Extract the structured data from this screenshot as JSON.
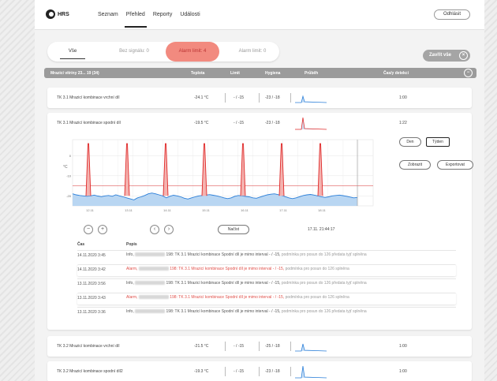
{
  "app": {
    "logo_text": "HRS"
  },
  "nav": [
    "Seznam",
    "Přehled",
    "Reporty",
    "Události"
  ],
  "logout_label": "Odhlásit",
  "filters": {
    "all": "Vše",
    "no_signal": "Bez signálu: 0",
    "alarm": "Alarm limit: 4",
    "alarm2": "Alarm limit: 0"
  },
  "close_all": "Zavřít vše",
  "table_header": {
    "device": "Mrazicí vitríny 23... 19 (34)",
    "temp": "Teplota",
    "limit": "Limit",
    "hyst": "Hygiena",
    "trend": "Průběh",
    "time": "Čas/y detekcí"
  },
  "rows": [
    {
      "name": "TK 3.1 Mrazicí kombinace vrchní díl",
      "temp": "-24.1 °C",
      "limit": "- / -15",
      "hyst": "-23 / -18",
      "time": "1:00"
    },
    {
      "name": "TK 3.1 Mrazicí kombinace spodní díl",
      "temp": "-19.5 °C",
      "limit": "- / -15",
      "hyst": "-23 / -18",
      "time": "1:22"
    },
    {
      "name": "TK 3.2 Mrazicí kombinace vrchní díl",
      "temp": "-21.5 °C",
      "limit": "- / -15",
      "hyst": "-25 / -18",
      "time": "1:00"
    },
    {
      "name": "TK 3.2 Mrazicí kombinace spodní díl2",
      "temp": "-19.3 °C",
      "limit": "- / -15",
      "hyst": "-23 / -18",
      "time": "1:00"
    }
  ],
  "expanded": {
    "buttons": {
      "day": "Den",
      "week": "Týden",
      "show": "Zobrazit",
      "export": "Exportovat",
      "load": "Načíst"
    },
    "ylabel": "°C",
    "timestamp": "17.11. 21:44:17",
    "log_headers": {
      "time": "Čas",
      "desc": "Popis"
    },
    "logs": [
      {
        "time": "14.11.2020 3:45",
        "type": "info",
        "prefix": "Info,",
        "text": "198: TK 3.1 Mrazicí kombinace Spodní díl je mimo interval - / -15,",
        "tail": "podmínka pro posun do 126 předata tyjť splněna"
      },
      {
        "time": "14.11.2020 3:42",
        "type": "alarm",
        "prefix": "Alarm,",
        "text": "198: TK 3.1 Mrazicí kombinace Spodní díl je mimo interval - / -15,",
        "tail": "podmínka pro posun do 126 splněna"
      },
      {
        "time": "13.11.2020 3:56",
        "type": "info",
        "prefix": "Info,",
        "text": "198: TK 3.1 Mrazicí kombinace Spodní díl je mimo interval - / -15,",
        "tail": "podmínka pro posun do 126 předata tyjť splněna"
      },
      {
        "time": "13.11.2020 3:43",
        "type": "alarm",
        "prefix": "Alarm,",
        "text": "198: TK 3.1 Mrazicí kombinace Spodní díl je mimo interval - / -15,",
        "tail": "podmínka pro posun do 126 splněna"
      },
      {
        "time": "13.11.2020 3:36",
        "type": "info",
        "prefix": "Info,",
        "text": "198: TK 3.1 Mrazicí kombinace Spodní díl je mimo interval - / -15,",
        "tail": "podmínka pro posun do 126 předata tyjť splněna"
      }
    ]
  },
  "chart_data": {
    "type": "line",
    "title": "",
    "xlabel": "",
    "ylabel": "°C",
    "x_ticks": [
      "12.11",
      "13.11",
      "14.11",
      "15.11",
      "16.11",
      "17.11",
      "18.11"
    ],
    "y_ticks": [
      "0",
      "-10",
      "-20"
    ],
    "ylim": [
      -25,
      8
    ],
    "limit_line": -15,
    "series": [
      {
        "values": [
          -19,
          -19.5,
          -19.8,
          -20,
          -20.2,
          -20,
          -19.6,
          -20.1,
          -20.4,
          -20,
          -19.8,
          -20.2,
          -19.5,
          -20,
          -20.5,
          -21,
          -21.5,
          -22,
          -21,
          -20.5,
          -19.8,
          -19,
          -18.6,
          -19,
          -19.5,
          -20,
          -21,
          -20.2,
          -19.7,
          -20,
          -20.5,
          -21.2,
          -21.6,
          -21,
          -20.5,
          -20,
          -19.8,
          -19.6,
          -19.4,
          -19.7,
          -20,
          -20.5,
          -21,
          -21.4,
          -21,
          -20.2,
          -19.8,
          -20,
          -20.3,
          -20.5,
          -21,
          -21.2,
          -20.6,
          -20,
          -19.5,
          -19.2,
          -19,
          -19.4,
          -19.8,
          -20.4,
          -21,
          -21.4,
          -21,
          -20.4,
          -19.8,
          -19.5,
          -19.3,
          -19.6,
          -20,
          -20.4,
          -20.8,
          -20.5,
          -20,
          -19.8,
          -19.6,
          -19.9,
          -20.2,
          -20.6,
          -21,
          -20.8
        ]
      },
      {
        "spikes": [
          6,
          6,
          6,
          6,
          6,
          6,
          6
        ]
      }
    ],
    "colors": {
      "temp": "#2b7fd9",
      "fill": "#b9d6f2",
      "spike": "#e02a2a",
      "limit": "#e05a5a"
    }
  }
}
